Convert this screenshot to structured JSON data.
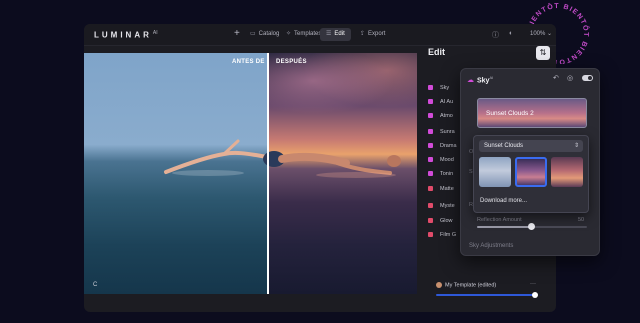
{
  "badge": {
    "text": "BIENTÔT BIENTÔT BIENTÔT",
    "color": "#c24bc8"
  },
  "app": {
    "brand": "LUMINAR",
    "brand_sup": "AI",
    "nav": [
      {
        "label": "Catalog",
        "icon": "folder-icon"
      },
      {
        "label": "Templates",
        "icon": "sparkle-icon"
      },
      {
        "label": "Edit",
        "icon": "sliders-icon",
        "active": true
      },
      {
        "label": "Export",
        "icon": "export-icon"
      }
    ],
    "zoom": "100%"
  },
  "photo": {
    "before_label": "ANTES DE",
    "after_label": "DESPUÉS",
    "corner_label": "C"
  },
  "edit": {
    "title": "Edit",
    "tools": [
      {
        "label": "Sky",
        "color": "#d24bd9"
      },
      {
        "label": "AI Au",
        "color": "#d24bd9"
      },
      {
        "label": "Atmo",
        "color": "#d24bd9"
      },
      {
        "label": "Sunra",
        "color": "#d24bd9"
      },
      {
        "label": "Drama",
        "color": "#d24bd9"
      },
      {
        "label": "Mood",
        "color": "#d24bd9"
      },
      {
        "label": "Tonin",
        "color": "#d24bd9"
      },
      {
        "label": "Matte",
        "color": "#e14b6a"
      },
      {
        "label": "Myste",
        "color": "#e14b6a"
      },
      {
        "label": "Glow",
        "color": "#e14b6a"
      },
      {
        "label": "Film G",
        "color": "#e14b6a"
      }
    ],
    "template_name": "My Template (edited)",
    "template_more": "···",
    "template_amount": 1.0
  },
  "sky_panel": {
    "title": "Sky",
    "title_sup": "AI",
    "selected_sky": "Sunset Clouds 2",
    "peek_letters": [
      "O",
      "S",
      "R"
    ],
    "reflection_label": "Reflection Amount",
    "reflection_value": "50",
    "reflection_amount": 0.5,
    "adjustments_label": "Sky Adjustments"
  },
  "sky_dropdown": {
    "category": "Sunset Clouds",
    "thumbnails": [
      {
        "name": "thumb-1",
        "selected": false
      },
      {
        "name": "thumb-2",
        "selected": true
      },
      {
        "name": "thumb-3",
        "selected": false
      }
    ],
    "download_label": "Download more..."
  },
  "colors": {
    "accent": "#3a6cf0",
    "sky_accent": "#d24bd9",
    "creative_accent": "#e14b6a",
    "background": "#0c0c1e"
  }
}
